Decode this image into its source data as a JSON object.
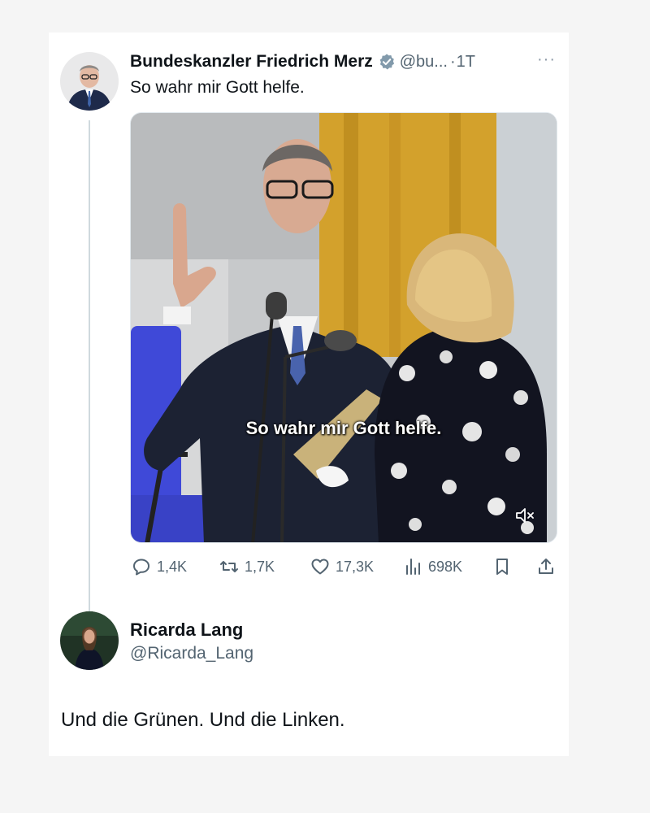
{
  "tweet": {
    "author_name": "Bundeskanzler Friedrich Merz",
    "handle": "@bu...",
    "separator": "·",
    "time": "1T",
    "more_label": "···",
    "text": "So wahr mir Gott helfe.",
    "video_caption": "So wahr mir Gott helfe.",
    "stats": {
      "replies": "1,4K",
      "retweets": "1,7K",
      "likes": "17,3K",
      "views": "698K"
    }
  },
  "reply": {
    "author_name": "Ricarda Lang",
    "handle": "@Ricarda_Lang",
    "text": "Und die Grünen. Und die Linken."
  },
  "colors": {
    "text_primary": "#0f1419",
    "text_secondary": "#536471",
    "verified": "#829aab",
    "thread_line": "#cfd9de"
  }
}
